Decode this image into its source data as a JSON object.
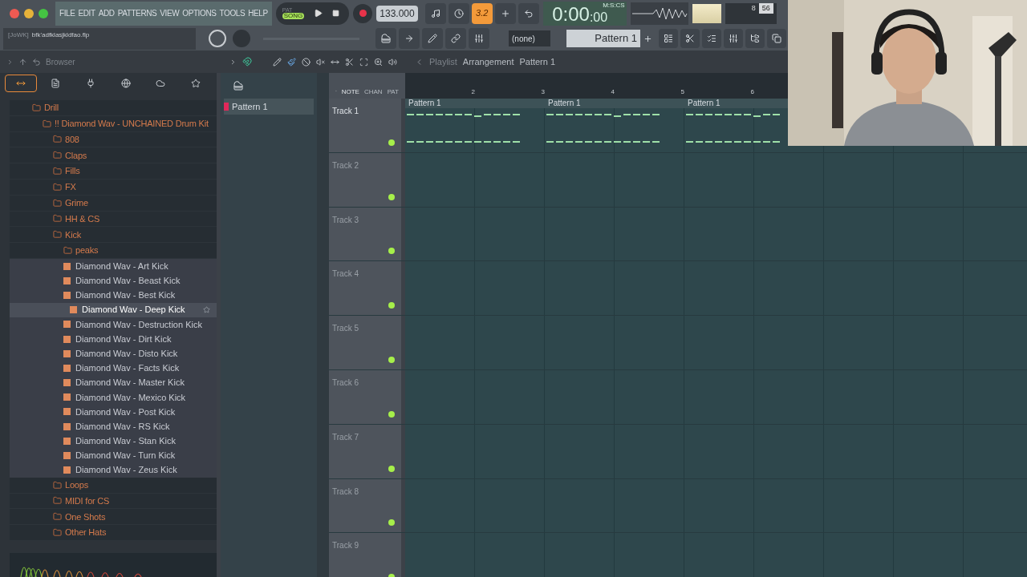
{
  "menu": [
    "FILE",
    "EDIT",
    "ADD",
    "PATTERNS",
    "VIEW",
    "OPTIONS",
    "TOOLS",
    "HELP"
  ],
  "transport": {
    "pat_label": "PAT",
    "song_label": "SONG",
    "song_selected": true,
    "tempo": "133.000"
  },
  "snap": {
    "label": "3.2",
    "on": true
  },
  "time": {
    "main": "0:00",
    "sub": ":00",
    "format": "M:S:CS"
  },
  "meter_numbers": [
    "8",
    "56"
  ],
  "project": {
    "tag": "[JoWK]",
    "file": "bfk'adfklasjkldfao.flp"
  },
  "channel_selector": "(none)",
  "pattern_selector": "Pattern 1",
  "browser": {
    "title": "Browser",
    "tabs": [
      {
        "selected": true
      },
      {
        "selected": false
      },
      {
        "selected": false
      },
      {
        "selected": false
      },
      {
        "selected": false
      },
      {
        "selected": false
      }
    ],
    "tree": [
      {
        "kind": "folder",
        "label": "Drill",
        "children": [
          {
            "kind": "folder",
            "label": "!! Diamond Wav - UNCHAINED Drum Kit",
            "children": [
              {
                "kind": "folder",
                "label": "808"
              },
              {
                "kind": "folder",
                "label": "Claps"
              },
              {
                "kind": "folder",
                "label": "Fills"
              },
              {
                "kind": "folder",
                "label": "FX"
              },
              {
                "kind": "folder",
                "label": "Grime"
              },
              {
                "kind": "folder",
                "label": "HH & CS"
              },
              {
                "kind": "folder",
                "label": "Kick",
                "children": [
                  {
                    "kind": "folder",
                    "label": "peaks"
                  },
                  {
                    "kind": "file",
                    "label": "Diamond Wav - Art Kick",
                    "selected": false
                  },
                  {
                    "kind": "file",
                    "label": "Diamond Wav - Beast Kick",
                    "selected": false
                  },
                  {
                    "kind": "file",
                    "label": "Diamond Wav - Best Kick",
                    "selected": false
                  },
                  {
                    "kind": "file",
                    "label": "Diamond Wav - Deep Kick",
                    "selected": true
                  },
                  {
                    "kind": "file",
                    "label": "Diamond Wav - Destruction Kick",
                    "selected": false
                  },
                  {
                    "kind": "file",
                    "label": "Diamond Wav - Dirt Kick",
                    "selected": false
                  },
                  {
                    "kind": "file",
                    "label": "Diamond Wav - Disto Kick",
                    "selected": false
                  },
                  {
                    "kind": "file",
                    "label": "Diamond Wav - Facts Kick",
                    "selected": false
                  },
                  {
                    "kind": "file",
                    "label": "Diamond Wav - Master Kick",
                    "selected": false
                  },
                  {
                    "kind": "file",
                    "label": "Diamond Wav - Mexico Kick",
                    "selected": false
                  },
                  {
                    "kind": "file",
                    "label": "Diamond Wav - Post Kick",
                    "selected": false
                  },
                  {
                    "kind": "file",
                    "label": "Diamond Wav - RS Kick",
                    "selected": false
                  },
                  {
                    "kind": "file",
                    "label": "Diamond Wav - Stan Kick",
                    "selected": false
                  },
                  {
                    "kind": "file",
                    "label": "Diamond Wav - Turn Kick",
                    "selected": false
                  },
                  {
                    "kind": "file",
                    "label": "Diamond Wav - Zeus Kick",
                    "selected": false
                  }
                ]
              },
              {
                "kind": "folder",
                "label": "Loops"
              },
              {
                "kind": "folder",
                "label": "MIDI for CS"
              },
              {
                "kind": "folder",
                "label": "One Shots"
              },
              {
                "kind": "folder",
                "label": "Other Hats"
              }
            ]
          }
        ]
      }
    ]
  },
  "playlist": {
    "breadcrumb": [
      "Playlist",
      "Arrangement",
      "Pattern 1"
    ],
    "tool_labels": [
      "NOTE",
      "CHAN",
      "PAT"
    ],
    "patterns": [
      "Pattern 1"
    ],
    "bars": [
      "2",
      "3",
      "4",
      "5",
      "6"
    ],
    "tracks": [
      {
        "name": "Track 1",
        "clips": [
          "Pattern 1",
          "Pattern 1",
          "Pattern 1"
        ]
      },
      {
        "name": "Track 2"
      },
      {
        "name": "Track 3"
      },
      {
        "name": "Track 4"
      },
      {
        "name": "Track 5"
      },
      {
        "name": "Track 6"
      },
      {
        "name": "Track 7"
      },
      {
        "name": "Track 8"
      },
      {
        "name": "Track 9"
      }
    ]
  },
  "webcam": {
    "kind": "picture"
  }
}
